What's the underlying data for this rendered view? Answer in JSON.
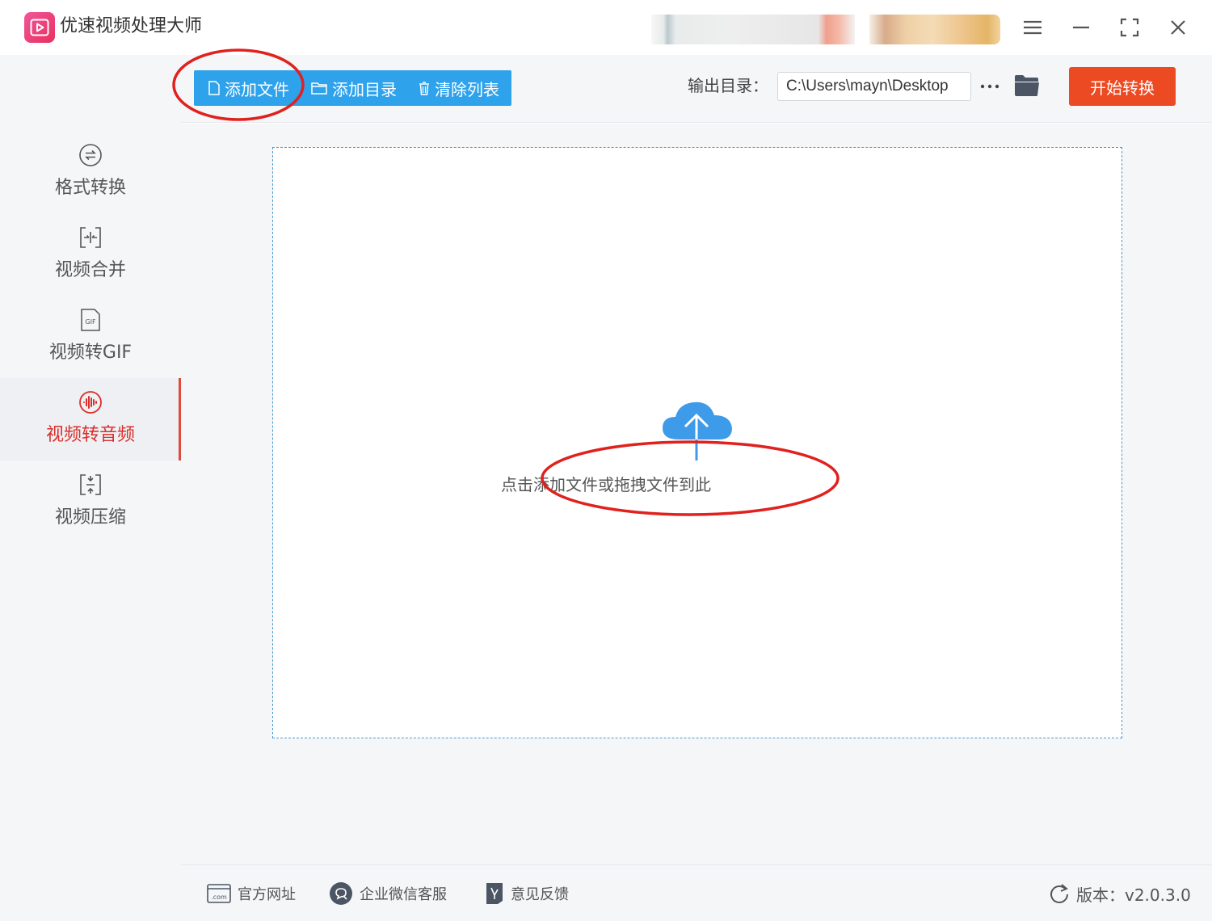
{
  "app": {
    "title": "优速视频处理大师"
  },
  "toolbar": {
    "add_file": "添加文件",
    "add_dir": "添加目录",
    "clear_list": "清除列表",
    "output_label": "输出目录：",
    "output_path": "C:\\Users\\mayn\\Desktop",
    "more_label": "···",
    "start": "开始转换"
  },
  "sidebar": {
    "items": [
      {
        "label": "格式转换",
        "icon": "format-convert-icon",
        "active": false
      },
      {
        "label": "视频合并",
        "icon": "merge-icon",
        "active": false
      },
      {
        "label": "视频转GIF",
        "icon": "gif-icon",
        "active": false
      },
      {
        "label": "视频转音频",
        "icon": "audio-wave-icon",
        "active": true
      },
      {
        "label": "视频压缩",
        "icon": "compress-icon",
        "active": false
      }
    ]
  },
  "dropzone": {
    "hint": "点击添加文件或拖拽文件到此"
  },
  "footer": {
    "website": "官方网址",
    "wechat": "企业微信客服",
    "feedback": "意见反馈",
    "version": "版本：v2.0.3.0"
  },
  "colors": {
    "accent_blue": "#2fa2ec",
    "start_button": "#ec4a22",
    "active_nav": "#d9302b",
    "annotation": "#e0211d"
  }
}
